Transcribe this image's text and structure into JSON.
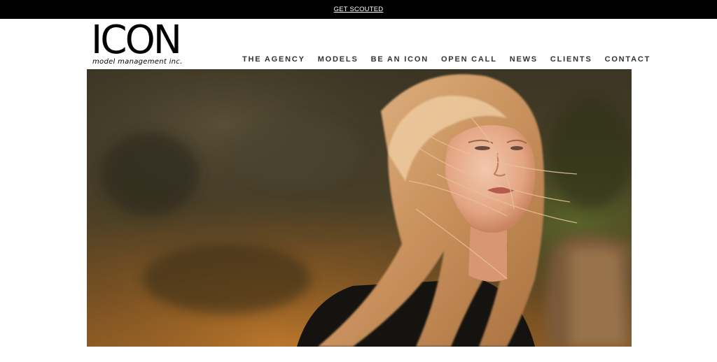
{
  "topbar": {
    "link_label": "GET SCOUTED"
  },
  "logo": {
    "word": "ICON",
    "tagline": "model management inc."
  },
  "nav": {
    "items": [
      {
        "label": "THE AGENCY",
        "name": "nav-item-the-agency"
      },
      {
        "label": "MODELS",
        "name": "nav-item-models"
      },
      {
        "label": "BE AN ICON",
        "name": "nav-item-be-an-icon"
      },
      {
        "label": "OPEN CALL",
        "name": "nav-item-open-call"
      },
      {
        "label": "NEWS",
        "name": "nav-item-news"
      },
      {
        "label": "CLIENTS",
        "name": "nav-item-clients"
      },
      {
        "label": "CONTACT",
        "name": "nav-item-contact"
      }
    ]
  },
  "colors": {
    "topbar_bg": "#000000",
    "topbar_text": "#ffffff",
    "nav_text": "#333333",
    "page_bg": "#ffffff"
  }
}
